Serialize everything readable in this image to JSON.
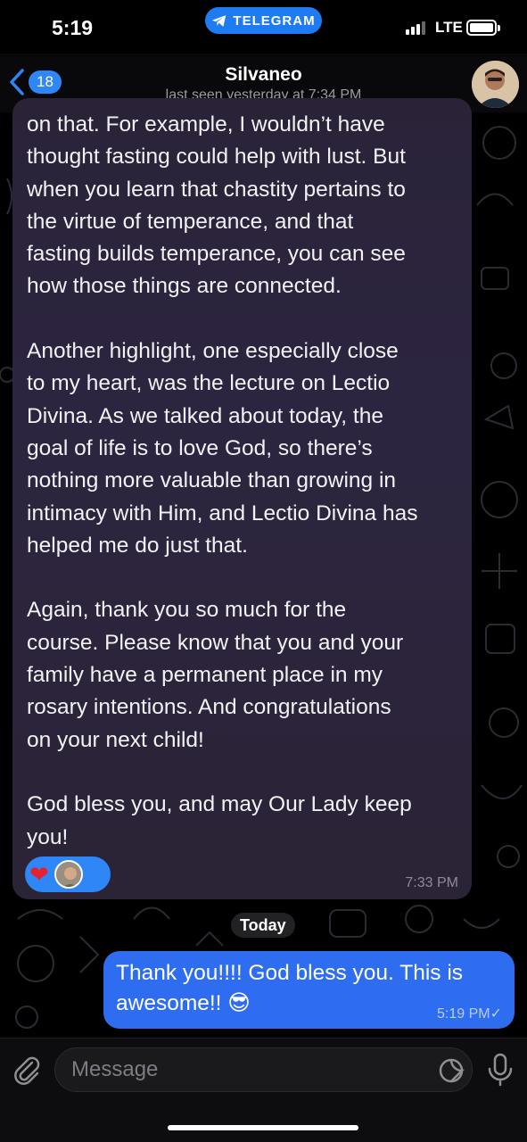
{
  "status_bar": {
    "time": "5:19",
    "app_pill": "TELEGRAM",
    "network": "LTE"
  },
  "header": {
    "back_badge": "18",
    "title": "Silvaneo",
    "subtitle": "last seen yesterday at 7:34 PM"
  },
  "messages": {
    "incoming": {
      "text": "on that. For example, I wouldn’t have\nthought fasting could help with lust. But\nwhen you learn that chastity pertains to\nthe virtue of temperance, and that\nfasting builds temperance, you can see\nhow those things are connected.\n\nAnother highlight, one especially close\nto my heart, was the lecture on Lectio\nDivina. As we talked about today, the\ngoal of life is to love God, so there’s\nnothing more valuable than growing in\nintimacy with Him, and Lectio Divina has\nhelped me do just that.\n\nAgain, thank you so much for the\ncourse. Please know that you and your\nfamily have a permanent place in my\nrosary intentions. And congratulations\non your next child!\n\nGod bless you, and may Our Lady keep\nyou!",
      "reaction": "❤",
      "time": "7:33 PM"
    },
    "date_separator": "Today",
    "outgoing": {
      "text": "Thank you!!!! God bless you. This is\nawesome!! 😎",
      "time": "5:19 PM✓"
    }
  },
  "composer": {
    "placeholder": "Message"
  },
  "colors": {
    "accent": "#2f86f6",
    "outgoing_bubble": "#2f6df0",
    "incoming_bubble": "#2a2338"
  }
}
